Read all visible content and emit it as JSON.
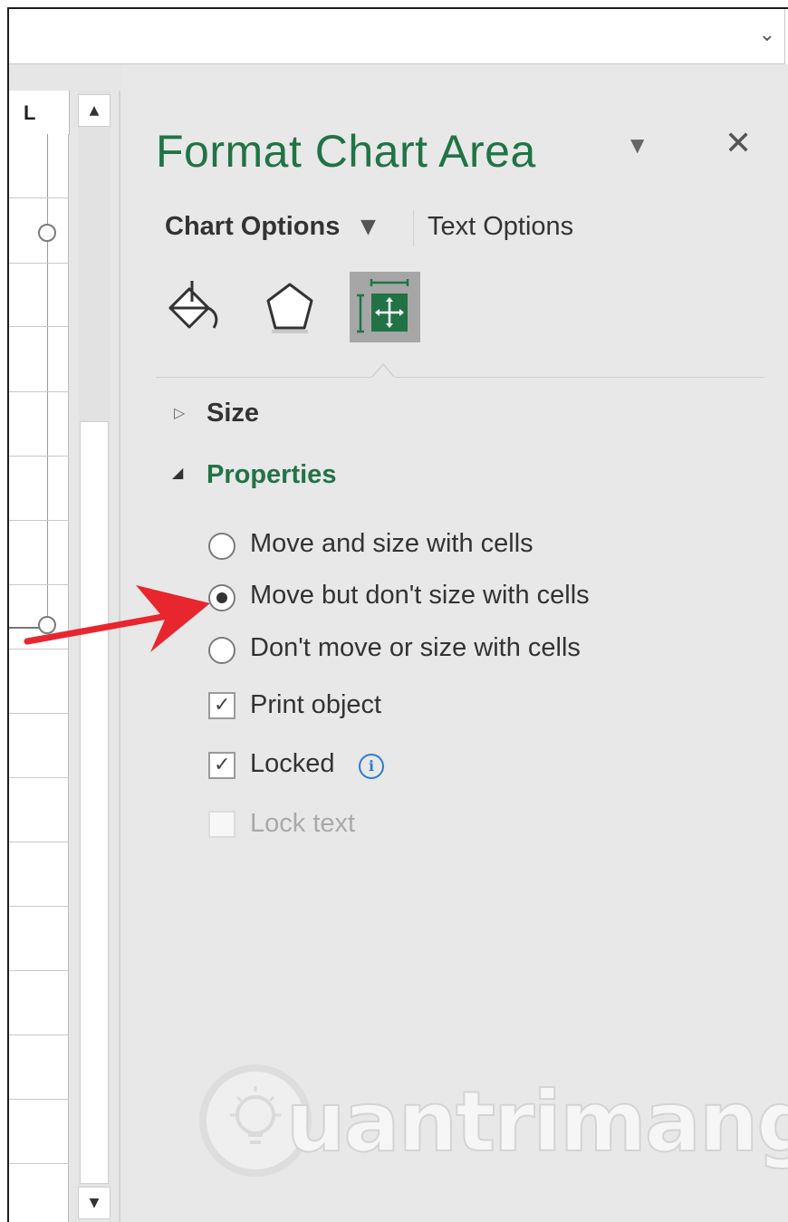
{
  "spreadsheet": {
    "column_letter": "L"
  },
  "pane": {
    "title": "Format Chart Area",
    "tabs": {
      "chart_options": "Chart Options",
      "text_options": "Text Options"
    },
    "icons": [
      "fill-line-icon",
      "effects-icon",
      "size-properties-icon"
    ],
    "sections": {
      "size": "Size",
      "properties": "Properties"
    },
    "options": {
      "move_and_size": "Move and size with cells",
      "move_no_size": "Move but don't size with cells",
      "dont_move": "Don't move or size with cells",
      "selected": "move_no_size"
    },
    "checkboxes": {
      "print_object": "Print object",
      "print_object_checked": true,
      "locked": "Locked",
      "locked_checked": true,
      "lock_text": "Lock text",
      "lock_text_checked": false,
      "lock_text_disabled": true
    }
  },
  "watermark": "uantrimang",
  "colors": {
    "accent": "#217346",
    "arrow": "#e8262e",
    "info": "#2b7bd6"
  }
}
